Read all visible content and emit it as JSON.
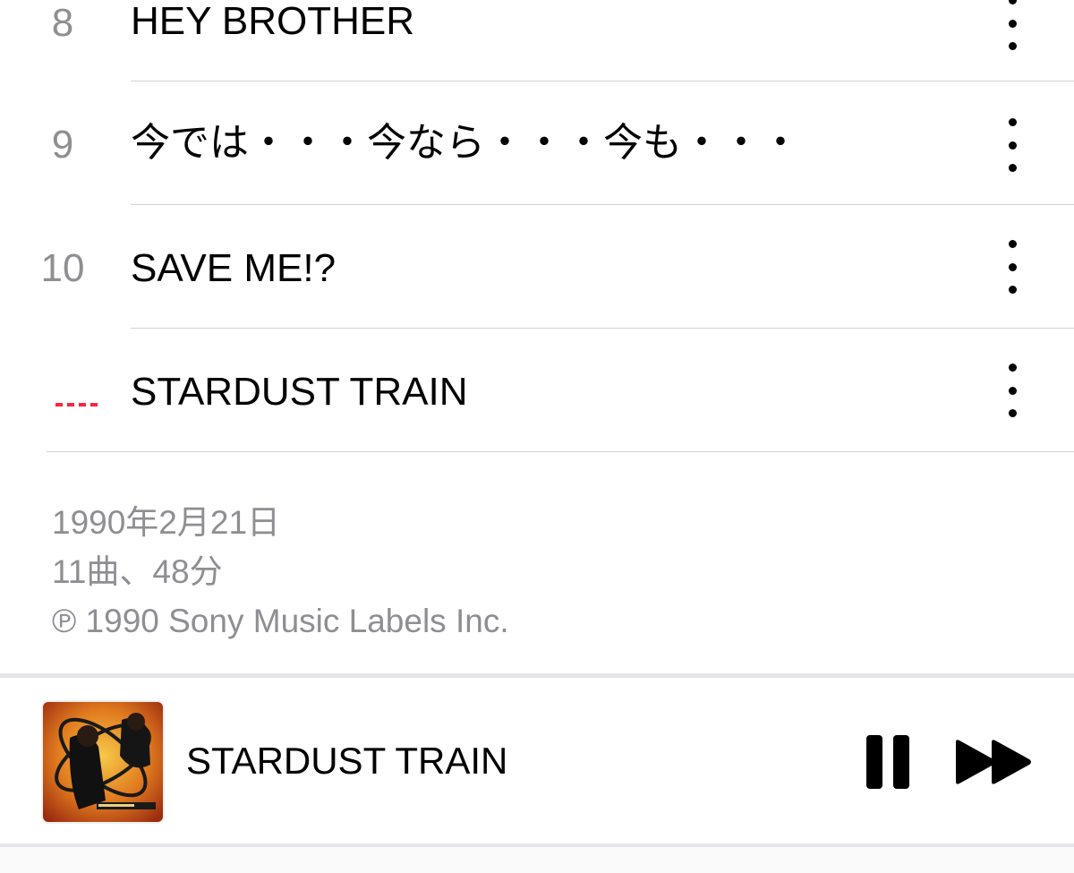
{
  "tracks": [
    {
      "number": "8",
      "title": "HEY BROTHER",
      "playing": false
    },
    {
      "number": "9",
      "title": "今では・・・今なら・・・今も・・・",
      "playing": false
    },
    {
      "number": "10",
      "title": "SAVE ME!?",
      "playing": false
    },
    {
      "number": "",
      "title": "STARDUST TRAIN",
      "playing": true
    }
  ],
  "album_info": {
    "release_date": "1990年2月21日",
    "track_summary": "11曲、48分",
    "copyright": "℗ 1990 Sony Music Labels Inc."
  },
  "mini_player": {
    "title": "STARDUST TRAIN",
    "artwork_icon": "album-artwork",
    "pause_icon": "pause-icon",
    "forward_icon": "fast-forward-icon"
  },
  "colors": {
    "accent": "#fa243c",
    "secondary_text": "#8e8e93",
    "separator": "#d1d1d6"
  }
}
